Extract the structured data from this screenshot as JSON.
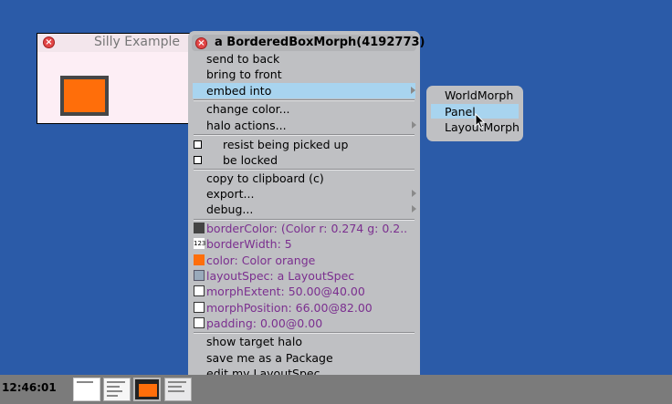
{
  "window": {
    "title": "Silly Example"
  },
  "menu": {
    "title": "a BorderedBoxMorph(4192773)",
    "items": [
      {
        "label": "send to back"
      },
      {
        "label": "bring to front"
      },
      {
        "label": "embed into",
        "submenu": true,
        "highlighted": true
      },
      {
        "label": "change color..."
      },
      {
        "label": "halo actions...",
        "submenu": true
      },
      {
        "label": "resist being picked up",
        "checkbox": true
      },
      {
        "label": "be locked",
        "checkbox": true
      },
      {
        "label": "copy to clipboard (c)"
      },
      {
        "label": "export...",
        "submenu": true
      },
      {
        "label": "debug...",
        "submenu": true
      },
      {
        "label": "borderColor: (Color r: 0.274 g: 0.2..",
        "icon": "color-swatch-icon"
      },
      {
        "label": "borderWidth: 5",
        "icon": "number-123-icon",
        "icon_text": "123"
      },
      {
        "label": "color: Color orange",
        "icon": "color-swatch-icon"
      },
      {
        "label": "layoutSpec: a LayoutSpec",
        "icon": "layout-icon"
      },
      {
        "label": "morphExtent: 50.00@40.00",
        "icon": "point-icon"
      },
      {
        "label": "morphPosition: 66.00@82.00",
        "icon": "point-icon"
      },
      {
        "label": "padding: 0.00@0.00",
        "icon": "point-icon"
      },
      {
        "label": "show target halo"
      },
      {
        "label": "save me as a Package"
      },
      {
        "label": "edit my LayoutSpec"
      }
    ]
  },
  "submenu": {
    "items": [
      {
        "label": "WorldMorph"
      },
      {
        "label": "Panel",
        "highlighted": true
      },
      {
        "label": "LayoutMorph"
      }
    ]
  },
  "taskbar": {
    "clock": "12:46:01"
  },
  "colors": {
    "desktop": "#2b5ba8",
    "menu_bg": "#bfc0c3",
    "highlight": "#a8d4ef",
    "property_text": "#7b2f8f",
    "orange": "#ff6e0a",
    "border_dark": "#464646"
  }
}
